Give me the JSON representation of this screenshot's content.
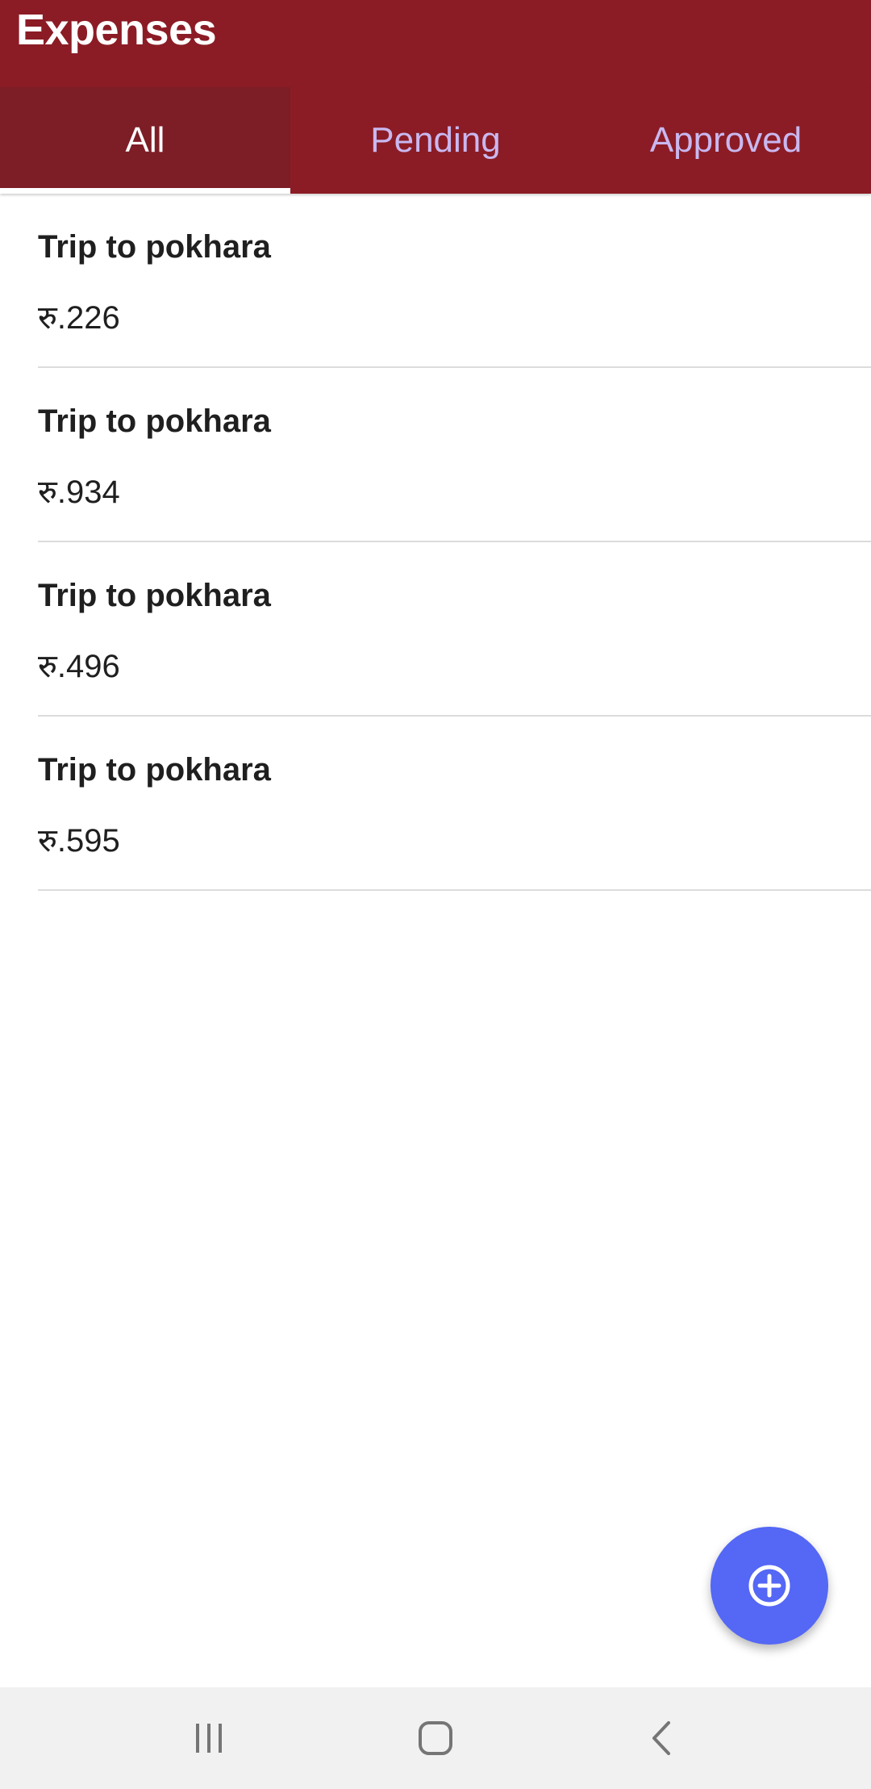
{
  "header": {
    "title": "Expenses",
    "background": "#8b1c25"
  },
  "tabs": [
    {
      "label": "All",
      "active": true
    },
    {
      "label": "Pending",
      "active": false
    },
    {
      "label": "Approved",
      "active": false
    }
  ],
  "expenses": [
    {
      "title": "Trip to pokhara",
      "amount": "रु.226"
    },
    {
      "title": "Trip to pokhara",
      "amount": "रु.934"
    },
    {
      "title": "Trip to pokhara",
      "amount": "रु.496"
    },
    {
      "title": "Trip to pokhara",
      "amount": "रु.595"
    }
  ],
  "fab": {
    "icon": "add-circle-icon",
    "color": "#5467f5"
  },
  "navigation": {
    "buttons": [
      {
        "icon": "recent-apps-icon"
      },
      {
        "icon": "home-icon"
      },
      {
        "icon": "back-icon"
      }
    ]
  }
}
